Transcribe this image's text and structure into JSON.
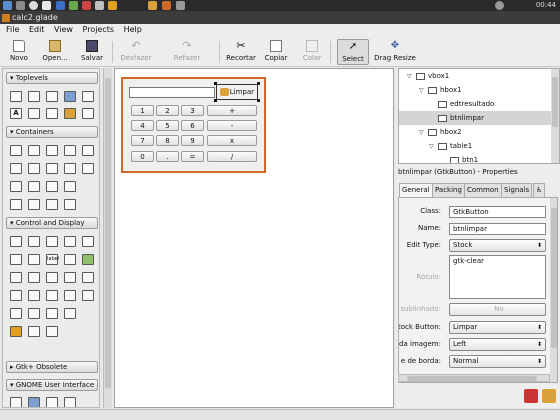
{
  "window": {
    "title": "calc2.glade",
    "clock": "00:44"
  },
  "menu": [
    "File",
    "Edit",
    "View",
    "Projects",
    "Help"
  ],
  "toolbar": {
    "new": "Novo",
    "open": "Open...",
    "save": "Salvar",
    "undo": "Desfazer",
    "redo": "Refazer",
    "cut": "Recortar",
    "copy": "Copiar",
    "paste": "Colar",
    "select": "Select",
    "drag_resize": "Drag Resize"
  },
  "palette": {
    "toplevels": "Toplevels",
    "containers": "Containers",
    "control_display": "Control and Display",
    "gtk_obsolete": "Gtk+ Obsolete",
    "gnome_ui": "GNOME User Interface",
    "label_tag": "label"
  },
  "calc": {
    "clear_button": "Limpar",
    "keys": [
      "1",
      "2",
      "3",
      "+",
      "4",
      "5",
      "6",
      "-",
      "7",
      "8",
      "9",
      "x",
      "0",
      ".",
      "=",
      "/"
    ]
  },
  "tree": {
    "rows": [
      "vbox1",
      "hbox1",
      "edtresultado",
      "btnlimpar",
      "hbox2",
      "table1",
      "btn1"
    ]
  },
  "properties": {
    "title": "btnlimpar (GtkButton) - Properties",
    "tabs": [
      "General",
      "Packing",
      "Common",
      "Signals",
      "♿"
    ],
    "class_label": "Class:",
    "class_value": "GtkButton",
    "name_label": "Name:",
    "name_value": "btnlimpar",
    "edit_type_label": "Edit Type:",
    "edit_type_value": "Stock",
    "stock_value": "gtk-clear",
    "rotulo_label": "Rótulo:",
    "sublinhado_label": "sublinhado:",
    "sublinhado_value": "No",
    "stock_button_label": "tock Button:",
    "stock_button_value": "Limpar",
    "imagem_label": "da imagem:",
    "imagem_value": "Left",
    "borda_label": "e de borda:",
    "borda_value": "Normal"
  }
}
